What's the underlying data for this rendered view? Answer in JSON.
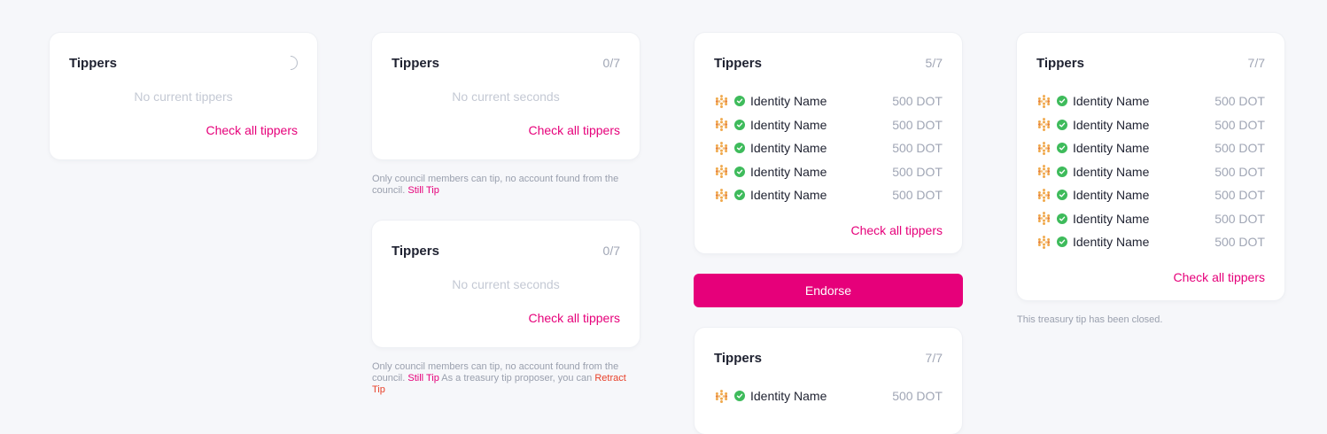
{
  "labels": {
    "tippers": "Tippers",
    "check_all": "Check all tippers",
    "no_tippers": "No current tippers",
    "no_seconds": "No current seconds",
    "identity": "Identity Name",
    "amount": "500 DOT",
    "endorse": "Endorse"
  },
  "counts": {
    "c0": "0/7",
    "c5": "5/7",
    "c7": "7/7"
  },
  "notes": {
    "council": "Only council members can tip, no account found from the council.",
    "still_tip": "Still Tip",
    "proposer": "As a treasury tip proposer, you can",
    "retract": "Retract Tip",
    "closed": "This treasury tip has been closed."
  },
  "colors": {
    "accent": "#e6007a",
    "verified": "#3ebb5b",
    "retract": "#e8412a"
  },
  "icons": {
    "loading": "loading-spinner-icon",
    "avatar": "polkadot-identicon-icon",
    "verified": "verified-check-icon"
  }
}
